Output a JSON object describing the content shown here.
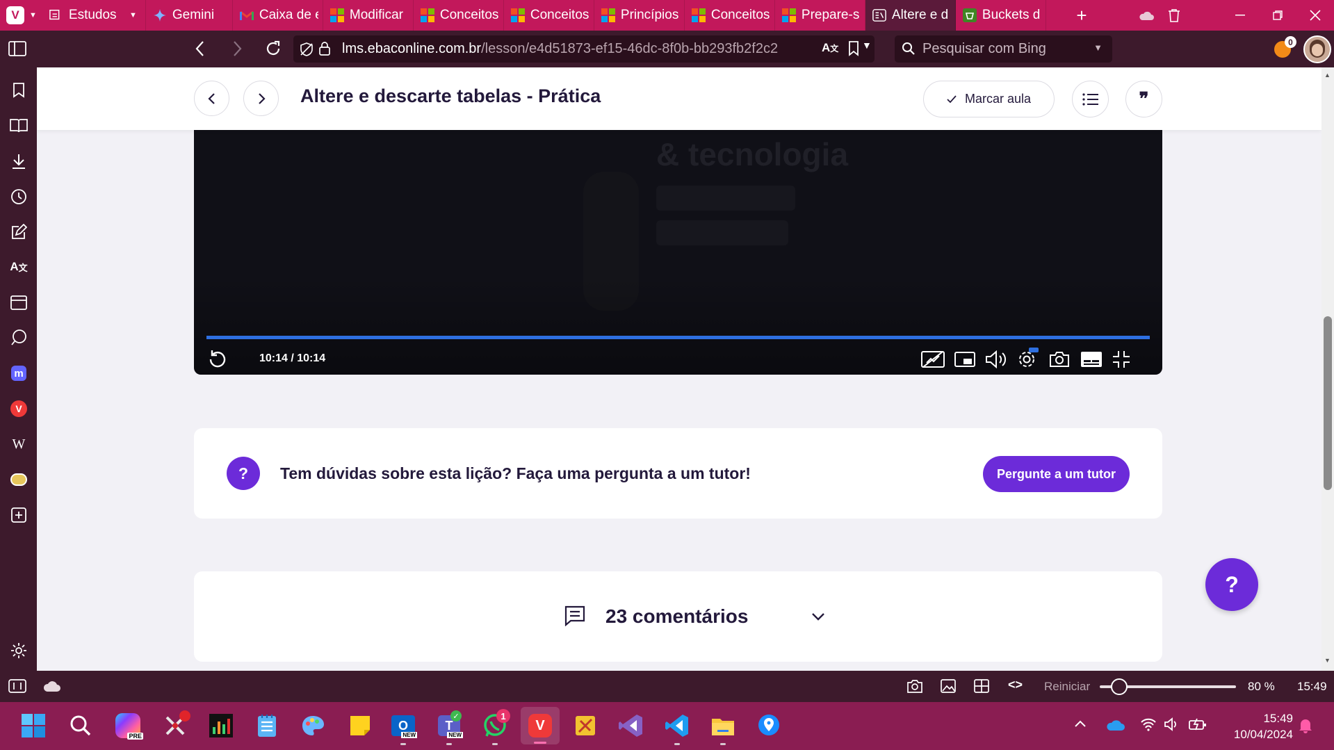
{
  "browser": {
    "tabs": [
      {
        "label": "Estudos",
        "icon": "tab-stack-icon"
      },
      {
        "label": "Gemini",
        "icon": "gemini-icon"
      },
      {
        "label": "Caixa de e",
        "icon": "gmail-icon"
      },
      {
        "label": "Modificar",
        "icon": "microsoft-icon"
      },
      {
        "label": "Conceitos",
        "icon": "microsoft-icon"
      },
      {
        "label": "Conceitos",
        "icon": "microsoft-icon"
      },
      {
        "label": "Princípios",
        "icon": "microsoft-icon"
      },
      {
        "label": "Conceitos",
        "icon": "microsoft-icon"
      },
      {
        "label": "Prepare-s",
        "icon": "microsoft-icon"
      },
      {
        "label": "Altere e d",
        "icon": "ebac-icon",
        "active": true
      },
      {
        "label": "Buckets d",
        "icon": "aws-icon"
      }
    ],
    "url": {
      "host": "lms.ebaconline.com.br",
      "path": "/lesson/e4d51873-ef15-46dc-8f0b-bb293fb2f2c2"
    },
    "search_placeholder": "Pesquisar com Bing",
    "notification_count": "0"
  },
  "lesson": {
    "title": "Altere e descarte tabelas - Prática",
    "mark_button": "Marcar aula",
    "video": {
      "overlay_text": "& tecnologia",
      "time": "10:14 / 10:14",
      "progress": 1.0
    },
    "ask": {
      "icon_text": "?",
      "text": "Tem dúvidas sobre esta lição? Faça uma pergunta a um tutor!",
      "button": "Pergunte a um tutor"
    },
    "comments": {
      "label": "23 comentários"
    },
    "help_fab": "?"
  },
  "statusbar": {
    "reset_label": "Reiniciar",
    "zoom": "80 %",
    "zoom_level": 0.15,
    "time": "15:49"
  },
  "taskbar": {
    "time": "15:49",
    "date": "10/04/2024",
    "whatsapp_badge": "1"
  },
  "colors": {
    "accent": "#6c2bd9",
    "tabbar": "#c2185b",
    "browser_chrome": "#3d1a2c",
    "taskbar": "#8a1d52"
  }
}
